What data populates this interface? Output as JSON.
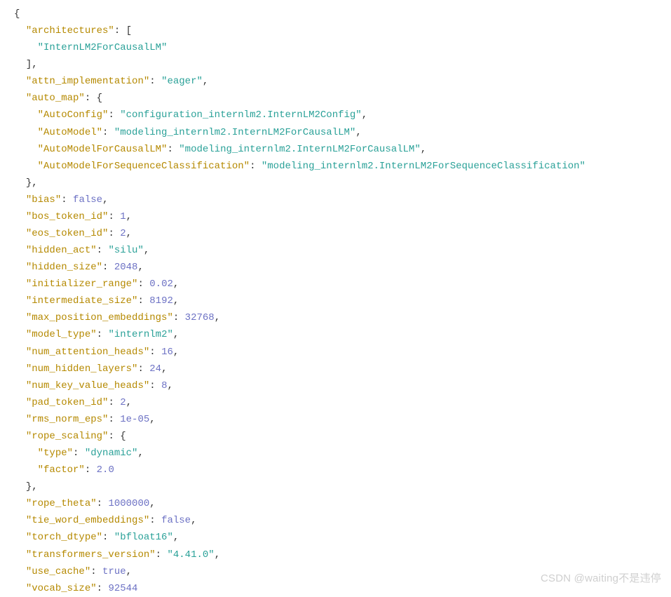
{
  "keys": {
    "architectures": "\"architectures\"",
    "attn_implementation": "\"attn_implementation\"",
    "auto_map": "\"auto_map\"",
    "AutoConfig": "\"AutoConfig\"",
    "AutoModel": "\"AutoModel\"",
    "AutoModelForCausalLM": "\"AutoModelForCausalLM\"",
    "AutoModelForSequenceClassification": "\"AutoModelForSequenceClassification\"",
    "bias": "\"bias\"",
    "bos_token_id": "\"bos_token_id\"",
    "eos_token_id": "\"eos_token_id\"",
    "hidden_act": "\"hidden_act\"",
    "hidden_size": "\"hidden_size\"",
    "initializer_range": "\"initializer_range\"",
    "intermediate_size": "\"intermediate_size\"",
    "max_position_embeddings": "\"max_position_embeddings\"",
    "model_type": "\"model_type\"",
    "num_attention_heads": "\"num_attention_heads\"",
    "num_hidden_layers": "\"num_hidden_layers\"",
    "num_key_value_heads": "\"num_key_value_heads\"",
    "pad_token_id": "\"pad_token_id\"",
    "rms_norm_eps": "\"rms_norm_eps\"",
    "rope_scaling": "\"rope_scaling\"",
    "type": "\"type\"",
    "factor": "\"factor\"",
    "rope_theta": "\"rope_theta\"",
    "tie_word_embeddings": "\"tie_word_embeddings\"",
    "torch_dtype": "\"torch_dtype\"",
    "transformers_version": "\"transformers_version\"",
    "use_cache": "\"use_cache\"",
    "vocab_size": "\"vocab_size\""
  },
  "vals": {
    "architectures_0": "\"InternLM2ForCausalLM\"",
    "attn_implementation": "\"eager\"",
    "AutoConfig": "\"configuration_internlm2.InternLM2Config\"",
    "AutoModel": "\"modeling_internlm2.InternLM2ForCausalLM\"",
    "AutoModelForCausalLM": "\"modeling_internlm2.InternLM2ForCausalLM\"",
    "AutoModelForSequenceClassification": "\"modeling_internlm2.InternLM2ForSequenceClassification\"",
    "bias": "false",
    "bos_token_id": "1",
    "eos_token_id": "2",
    "hidden_act": "\"silu\"",
    "hidden_size": "2048",
    "initializer_range": "0.02",
    "intermediate_size": "8192",
    "max_position_embeddings": "32768",
    "model_type": "\"internlm2\"",
    "num_attention_heads": "16",
    "num_hidden_layers": "24",
    "num_key_value_heads": "8",
    "pad_token_id": "2",
    "rms_norm_eps": "1e-05",
    "rope_type": "\"dynamic\"",
    "rope_factor": "2.0",
    "rope_theta": "1000000",
    "tie_word_embeddings": "false",
    "torch_dtype": "\"bfloat16\"",
    "transformers_version": "\"4.41.0\"",
    "use_cache": "true",
    "vocab_size": "92544"
  },
  "punct": {
    "lb": "{",
    "rb": "}",
    "ls": "[",
    "rs": "],",
    "rbcomma": "},",
    "colon_space": ": ",
    "colon_space_ls": ": [",
    "colon_space_lb": ": {",
    "comma": ","
  },
  "watermark": "CSDN @waiting不是违停"
}
